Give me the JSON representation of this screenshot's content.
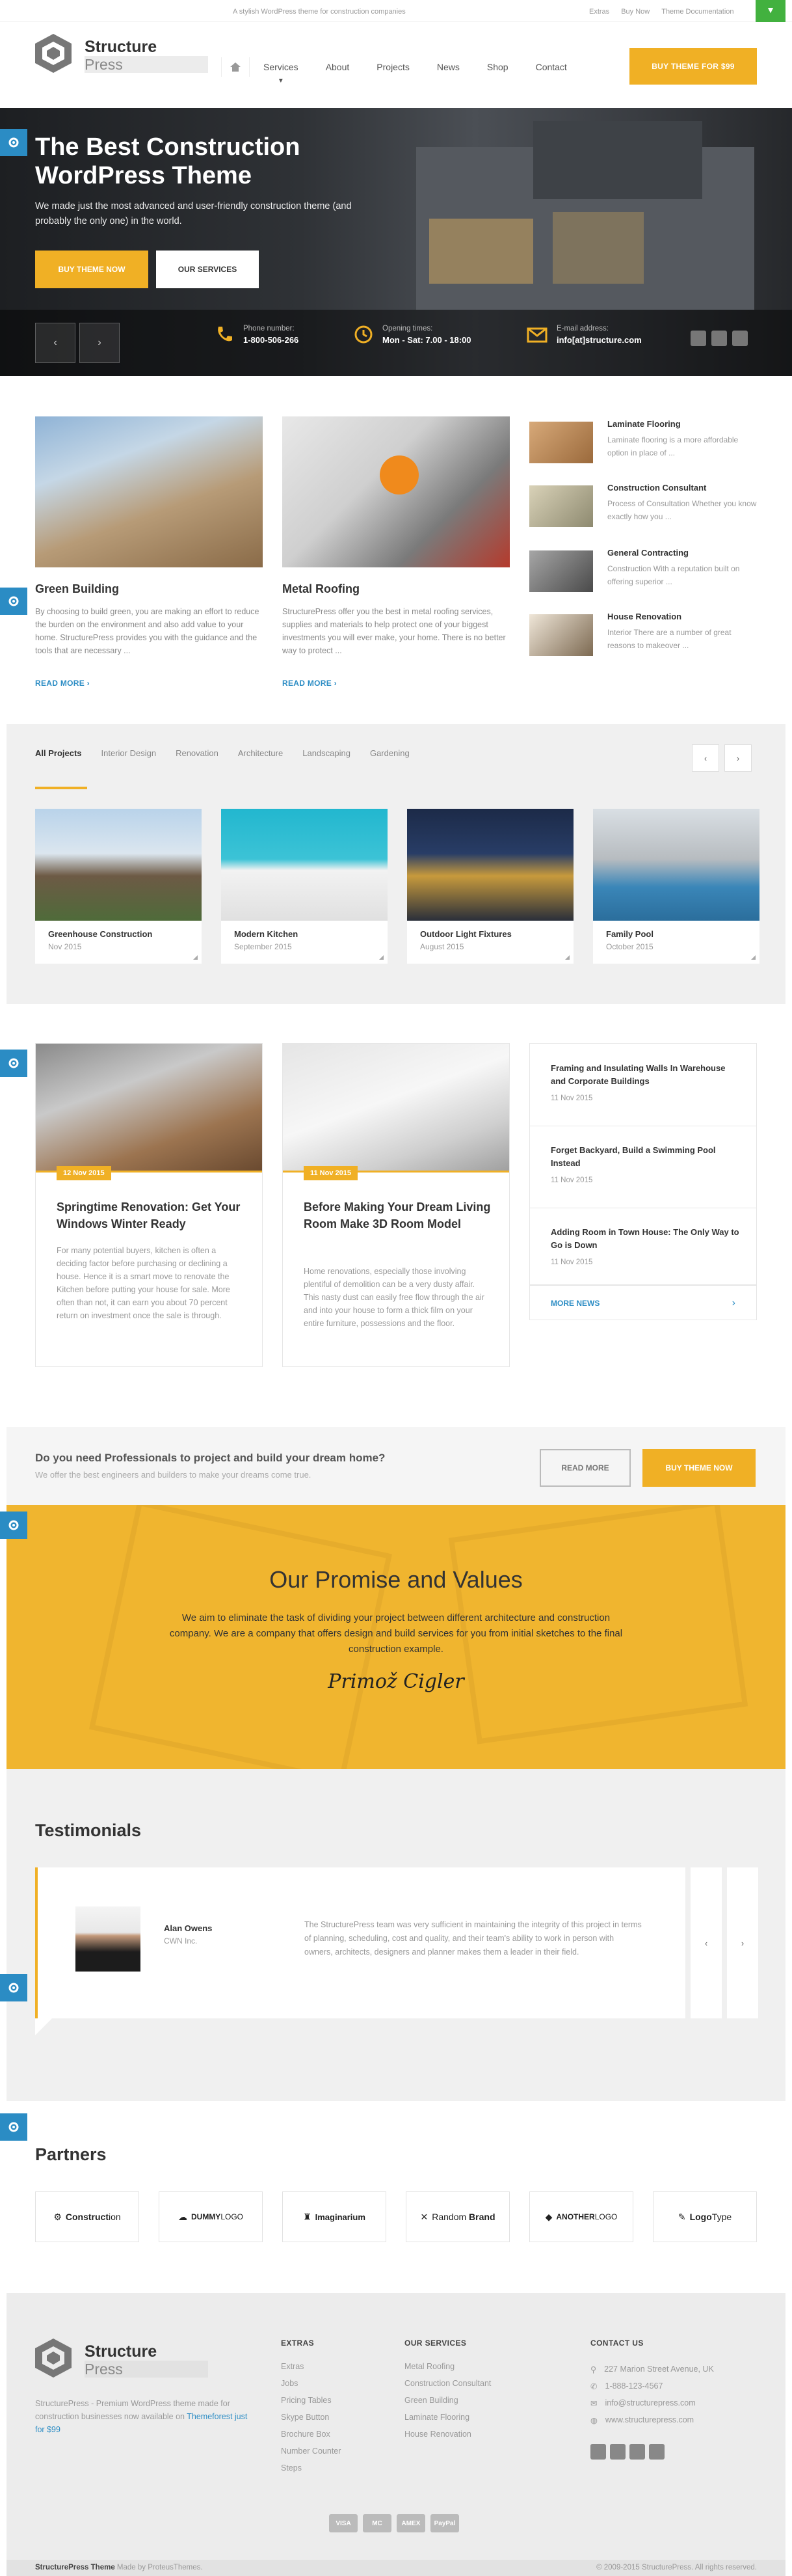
{
  "topbar": {
    "tagline": "A stylish WordPress theme for construction companies",
    "links": [
      "Extras",
      "Buy Now",
      "Theme Documentation"
    ]
  },
  "logo": {
    "line1": "Structure",
    "line2": "Press"
  },
  "nav": {
    "items": [
      "Services",
      "About",
      "Projects",
      "News",
      "Shop",
      "Contact"
    ],
    "active": "Services",
    "buy": "BUY THEME FOR $99"
  },
  "hero": {
    "title": "The Best Construction WordPress Theme",
    "text": "We made just the most advanced and user-friendly construction theme (and probably the only one) in the world.",
    "btn1": "BUY THEME NOW",
    "btn2": "OUR SERVICES",
    "info": [
      {
        "label": "Phone number:",
        "value": "1-800-506-266",
        "icon": "phone-icon"
      },
      {
        "label": "Opening times:",
        "value": "Mon - Sat: 7.00 - 18:00",
        "icon": "clock-icon"
      },
      {
        "label": "E-mail address:",
        "value": "info[at]structure.com",
        "icon": "mail-icon"
      }
    ]
  },
  "services": {
    "featured": [
      {
        "title": "Green Building",
        "text": "By choosing to build green, you are making an effort to reduce the burden on the environment and also add value to your home. StructurePress provides you with the guidance and the tools that are necessary ...",
        "more": "READ MORE"
      },
      {
        "title": "Metal Roofing",
        "text": "StructurePress offer you the best in metal roofing services, supplies and materials to help protect one of your biggest investments you will ever make, your home. There is no better way to protect ...",
        "more": "READ MORE"
      }
    ],
    "list": [
      {
        "title": "Laminate Flooring",
        "text": "Laminate flooring is a more affordable option in place of ..."
      },
      {
        "title": "Construction Consultant",
        "text": "Process of Consultation Whether you know exactly how you ..."
      },
      {
        "title": "General Contracting",
        "text": "Construction With a reputation built on offering superior ..."
      },
      {
        "title": "House Renovation",
        "text": "Interior There are a number of great reasons to makeover ..."
      }
    ]
  },
  "projects": {
    "tabs": [
      "All Projects",
      "Interior Design",
      "Renovation",
      "Architecture",
      "Landscaping",
      "Gardening"
    ],
    "items": [
      {
        "title": "Greenhouse Construction",
        "date": "Nov 2015"
      },
      {
        "title": "Modern Kitchen",
        "date": "September 2015"
      },
      {
        "title": "Outdoor Light Fixtures",
        "date": "August 2015"
      },
      {
        "title": "Family Pool",
        "date": "October 2015"
      }
    ]
  },
  "blog": {
    "posts": [
      {
        "date": "12 Nov 2015",
        "title": "Springtime Renovation: Get Your Windows Winter Ready",
        "text": "For many potential buyers, kitchen is often a deciding factor before purchasing or declining a house. Hence it is a smart move to renovate the Kitchen before putting your house for sale. More often than not, it can earn you about 70 percent return on investment once the sale is through."
      },
      {
        "date": "11 Nov 2015",
        "title": "Before Making Your Dream Living Room Make 3D Room Model",
        "text": "Home renovations, especially those involving plentiful of demolition can be a very dusty affair. This nasty dust can easily free flow through the air and into your house to form a thick film on your entire furniture, possessions and the floor."
      }
    ],
    "news": [
      {
        "title": "Framing and Insulating Walls In Warehouse and Corporate Buildings",
        "date": "11 Nov 2015"
      },
      {
        "title": "Forget Backyard, Build a Swimming Pool Instead",
        "date": "11 Nov 2015"
      },
      {
        "title": "Adding Room in Town House: The Only Way to Go is Down",
        "date": "11 Nov 2015"
      }
    ],
    "more": "MORE NEWS"
  },
  "cta": {
    "title": "Do you need Professionals to project and build your dream home?",
    "sub": "We offer the best engineers and builders to make your dreams come true.",
    "read": "READ MORE",
    "buy": "BUY THEME NOW"
  },
  "promise": {
    "title": "Our Promise and Values",
    "text": "We aim to eliminate the task of dividing your project between different architecture and construction company. We are a company that offers design and build services for you from initial sketches to the final construction example.",
    "signature": "Primož Cigler"
  },
  "testimonials": {
    "title": "Testimonials",
    "name": "Alan Owens",
    "company": "CWN Inc.",
    "quote": "The StructurePress team was very sufficient in maintaining the integrity of this project in terms of planning, scheduling, cost and quality, and their team's ability to work in person with owners, architects, designers and planner makes them a leader in their field."
  },
  "partners": {
    "title": "Partners",
    "logos": [
      {
        "pre": "",
        "bold": "Construct",
        "post": "ion"
      },
      {
        "pre": "",
        "bold": "DUMMY",
        "post": "LOGO"
      },
      {
        "pre": "",
        "bold": "Imaginarium",
        "post": ""
      },
      {
        "pre": "Random ",
        "bold": "Brand",
        "post": ""
      },
      {
        "pre": "",
        "bold": "ANOTHER",
        "post": "LOGO"
      },
      {
        "pre": "",
        "bold": "Logo",
        "post": "Type"
      }
    ]
  },
  "footer": {
    "desc": "StructurePress - Premium WordPress theme made for construction businesses now available on",
    "link": "Themeforest just for $99",
    "extras_title": "EXTRAS",
    "extras": [
      "Extras",
      "Jobs",
      "Pricing Tables",
      "Skype Button",
      "Brochure Box",
      "Number Counter",
      "Steps"
    ],
    "services_title": "OUR SERVICES",
    "services": [
      "Metal Roofing",
      "Construction Consultant",
      "Green Building",
      "Laminate Flooring",
      "House Renovation"
    ],
    "contact_title": "CONTACT US",
    "contact": [
      "227 Marion Street Avenue, UK",
      "1-888-123-4567",
      "info@structurepress.com",
      "www.structurepress.com"
    ],
    "payments": [
      "VISA",
      "MC",
      "AMEX",
      "PayPal"
    ]
  },
  "bottom": {
    "left_bold": "StructurePress Theme",
    "left": "Made by ProteusThemes.",
    "right": "© 2009-2015 StructurePress. All rights reserved."
  },
  "colors": {
    "accent": "#f0b025",
    "link": "#2b8cc4",
    "topbar_green": "#42b13f"
  }
}
